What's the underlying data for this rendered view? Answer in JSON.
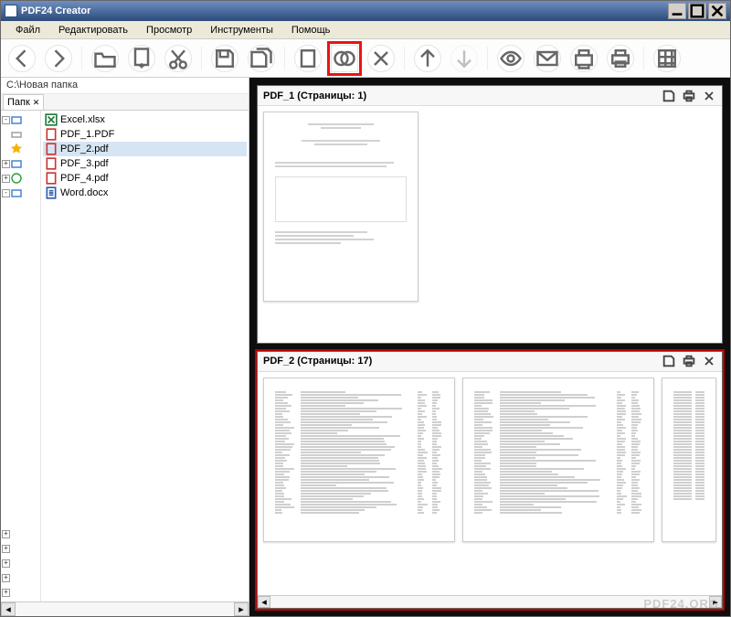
{
  "title": "PDF24 Creator",
  "menus": [
    "Файл",
    "Редактировать",
    "Просмотр",
    "Инструменты",
    "Помощь"
  ],
  "toolbar_icons": [
    "back-icon",
    "forward-icon",
    "sep",
    "open-icon",
    "add-icon",
    "cut-icon",
    "sep",
    "save-icon",
    "save-all-icon",
    "sep",
    "blank-page-icon",
    "merge-icon",
    "delete-icon",
    "sep",
    "arrow-up-icon",
    "arrow-down-icon",
    "sep",
    "view-icon",
    "mail-icon",
    "fax-icon",
    "print-icon",
    "sep",
    "calc-icon"
  ],
  "highlighted_tool": "merge-icon",
  "path": "C:\\Новая папка",
  "sidebar_tab_label": "Папк",
  "nav_items": [
    {
      "expand": "-",
      "color": "#3a7bd5"
    },
    {
      "expand": "",
      "color": "#999"
    },
    {
      "expand": "",
      "color": "#f5b300"
    },
    {
      "expand": "+",
      "color": "#3a7bd5"
    },
    {
      "expand": "+",
      "color": "#2a9d3a"
    },
    {
      "expand": "-",
      "color": "#3a7bd5"
    }
  ],
  "files": [
    {
      "icon": "xls",
      "label": "Excel.xlsx",
      "sel": false
    },
    {
      "icon": "pdf",
      "label": "PDF_1.PDF",
      "sel": false
    },
    {
      "icon": "pdf",
      "label": "PDF_2.pdf",
      "sel": true
    },
    {
      "icon": "pdf",
      "label": "PDF_3.pdf",
      "sel": false
    },
    {
      "icon": "pdf",
      "label": "PDF_4.pdf",
      "sel": false
    },
    {
      "icon": "doc",
      "label": "Word.docx",
      "sel": false
    }
  ],
  "documents": [
    {
      "title": "PDF_1 (Страницы: 1)",
      "pages": 1,
      "selected": false
    },
    {
      "title": "PDF_2 (Страницы: 17)",
      "pages": 17,
      "selected": true
    }
  ],
  "watermark": "PDF24.ORG"
}
